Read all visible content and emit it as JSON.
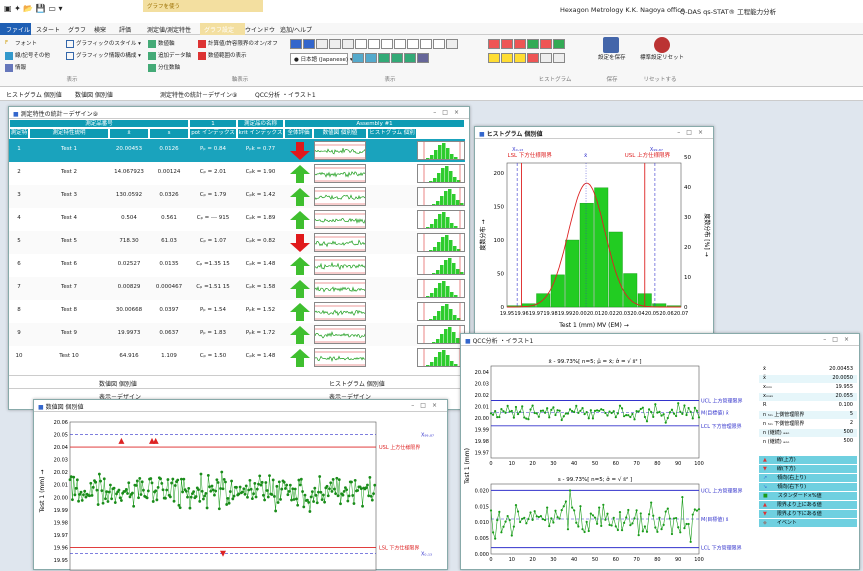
{
  "app": {
    "title": "Hexagon Metrology K.K.  Nagoya office",
    "product": "Q-DAS qs-STAT® 工程能力分析",
    "context_group": "グラフを使う"
  },
  "menu_tabs": [
    "ファイル",
    "スタート",
    "グラフ",
    "検宩",
    "評価",
    "測定値/測定特性",
    "グラフ設定",
    "ウインドウ",
    "追加/ヘルプ"
  ],
  "ribbon": {
    "col1": [
      "フォント",
      "線/記号その他",
      "情報"
    ],
    "col2": [
      "グラフィックのスタイル",
      "グラフィック情報の構成"
    ],
    "col3": [
      "数値軸",
      "追加データ軸",
      "分位数軸"
    ],
    "col4": [
      "計算値/許容限界のオン/オフ",
      "数値範囲の表示"
    ],
    "language": "日本語 (Japanese)",
    "save": "設定を保存",
    "reset": "標準設定リセット",
    "groups": [
      "表示",
      "軸表示",
      "表示",
      "ヒストグラム",
      "保存",
      "リセットする"
    ]
  },
  "doc_tabs": [
    "ヒストグラム  個別値",
    "数値図  個別値",
    "測定特性の統計－デザイン⑨",
    "QCC分析 ・イラスト1"
  ],
  "table_window": {
    "title": "測定特性の統計－デザイン⑨",
    "group_headers": [
      "測定品番号",
      "1",
      "測定品の名称",
      "Assembly #1"
    ],
    "columns": [
      "測定特性番",
      "測定特性説明",
      "x̄",
      "s",
      "pot インデックス",
      "krit インデックス",
      "全体評価",
      "数値図 個別値",
      "ヒストグラム 個別値"
    ],
    "rows": [
      {
        "no": "1",
        "name": "Test 1",
        "mean": "20.00453",
        "s": "0.0126",
        "pot": "Pₚ = 0.84",
        "krit": "Pₚk = 0.77",
        "ok": false
      },
      {
        "no": "2",
        "name": "Test 2",
        "mean": "14.067923",
        "s": "0.00124",
        "pot": "Cₚ = 2.01",
        "krit": "Cₚk = 1.90",
        "ok": true
      },
      {
        "no": "3",
        "name": "Test 3",
        "mean": "130.0592",
        "s": "0.0326",
        "pot": "Cₚ = 1.79",
        "krit": "Cₚk = 1.42",
        "ok": true
      },
      {
        "no": "4",
        "name": "Test 4",
        "mean": "0.504",
        "s": "0.561",
        "pot": "Cₚ = --- 915",
        "krit": "Cₚk = 1.89",
        "ok": true
      },
      {
        "no": "5",
        "name": "Test 5",
        "mean": "718.30",
        "s": "61.03",
        "pot": "Cₚ = 1.07",
        "krit": "Cₚk = 0.82",
        "ok": false
      },
      {
        "no": "6",
        "name": "Test 6",
        "mean": "0.02527",
        "s": "0.0135",
        "pot": "Cₚ =1.35 15",
        "krit": "Cₚk = 1.48",
        "ok": true
      },
      {
        "no": "7",
        "name": "Test 7",
        "mean": "0.00829",
        "s": "0.000467",
        "pot": "Cₚ =1.51 15",
        "krit": "Cₚk = 1.58",
        "ok": true
      },
      {
        "no": "8",
        "name": "Test 8",
        "mean": "30.00668",
        "s": "0.0397",
        "pot": "Pₚ = 1.54",
        "krit": "Pₚk = 1.52",
        "ok": true
      },
      {
        "no": "9",
        "name": "Test 9",
        "mean": "19.9973",
        "s": "0.0637",
        "pot": "Pₚ = 1.83",
        "krit": "Pₚk = 1.72",
        "ok": true
      },
      {
        "no": "10",
        "name": "Test 10",
        "mean": "64.916",
        "s": "1.109",
        "pot": "Cₚ = 1.50",
        "krit": "Cₚk = 1.48",
        "ok": true
      }
    ],
    "footer": [
      "数値図  個別値",
      "ヒストグラム  個別値",
      "表示－デザイン"
    ],
    "colors": {
      "header": "#0e9bb3",
      "selected": "#1aa3bd",
      "ok": "#3fbf2f",
      "ng": "#e0191b"
    }
  },
  "hist_window": {
    "title": "ヒストグラム  個別値",
    "xlabel": "Test 1 (mm)  MV (EM) →",
    "ylabel": "度数分布 →",
    "ylabel2": "度数分布 [%] →",
    "lsl_label": "LSL 下方仕様限界",
    "usl_label": "USL 上方仕様限界",
    "xq_lo": "X₀.₁₃",
    "xq_hi": "X₉₉.₈₇",
    "xbar": "x̄"
  },
  "qcc_window": {
    "title": "QCC分析 ・イラスト1",
    "top_caption": "x̄ - 99.73%[ n=5; μ̂ = x̄; σ̂ = √ s̄² ]",
    "bottom_caption": "s - 99.73%[ n=5; σ̂ = √ s̄² ]",
    "ylabel": "Test 1 (mm)",
    "ucl": "UCL 上方管理限界",
    "lcl": "LCL 下方管理限界",
    "mid": "M(目標値) x̄",
    "mid2": "M(目標値) s̄",
    "stats": [
      {
        "k": "x̄",
        "v": "20.00453"
      },
      {
        "k": "x̃",
        "v": "20.0050"
      },
      {
        "k": "xₘᵢₙ",
        "v": "19.955"
      },
      {
        "k": "xₘₐₓ",
        "v": "20.055"
      },
      {
        "k": "R",
        "v": "0.100"
      },
      {
        "k": "n ₕᵢₙ 上側管理限界",
        "v": "5"
      },
      {
        "k": "n ₕᵢₙ 下側管理限界",
        "v": "2"
      },
      {
        "k": "n (継続) ₑₑₒ",
        "v": "500"
      },
      {
        "k": "n (継続) ₑₒₒ",
        "v": "500"
      }
    ],
    "legend": [
      "線(上方)",
      "線(下方)",
      "傾向(右上り)",
      "傾向(右下り)",
      "スタンダード×%値",
      "限界より上にある値",
      "限界より下にある値",
      "イベント"
    ]
  },
  "value_window": {
    "title": "数値図  個別値",
    "ylabel": "Test 1 (mm) →",
    "usl": "USL 上方仕様限界",
    "lsl": "LSL 下方仕様限界",
    "xq_hi": "X₉₉.₈₇",
    "xq_lo": "X₀.₁₃"
  },
  "chart_data": [
    {
      "type": "bar",
      "title": "",
      "xlabel": "Test 1 (mm)  MV (EM) →",
      "ylabel": "度数分布 →",
      "categories": [
        "19.95",
        "19.96",
        "19.97",
        "19.98",
        "19.99",
        "20.00",
        "20.01",
        "20.02",
        "20.03",
        "20.04",
        "20.05",
        "20.06"
      ],
      "values": [
        2,
        5,
        20,
        48,
        100,
        155,
        178,
        112,
        50,
        20,
        5,
        2
      ],
      "ylim": [
        0,
        215
      ],
      "xlim": [
        19.95,
        20.07
      ],
      "lsl": 19.96,
      "usl": 20.045
    },
    {
      "type": "line",
      "title": "数値図  個別値",
      "ylabel": "Test 1 (mm) →",
      "ylim": [
        19.95,
        20.06
      ],
      "usl": 20.04,
      "lsl": 19.96,
      "n": 500
    },
    {
      "type": "line",
      "title": "x̄",
      "ylim": [
        19.965,
        20.045
      ],
      "xlim": [
        0,
        100
      ],
      "ucl": 20.015,
      "lcl": 19.993,
      "mean": 20.0045
    },
    {
      "type": "line",
      "title": "s",
      "ylim": [
        0,
        0.022
      ],
      "xlim": [
        0,
        100
      ],
      "ucl": 0.02,
      "lcl": 0.002,
      "mean": 0.011
    }
  ]
}
